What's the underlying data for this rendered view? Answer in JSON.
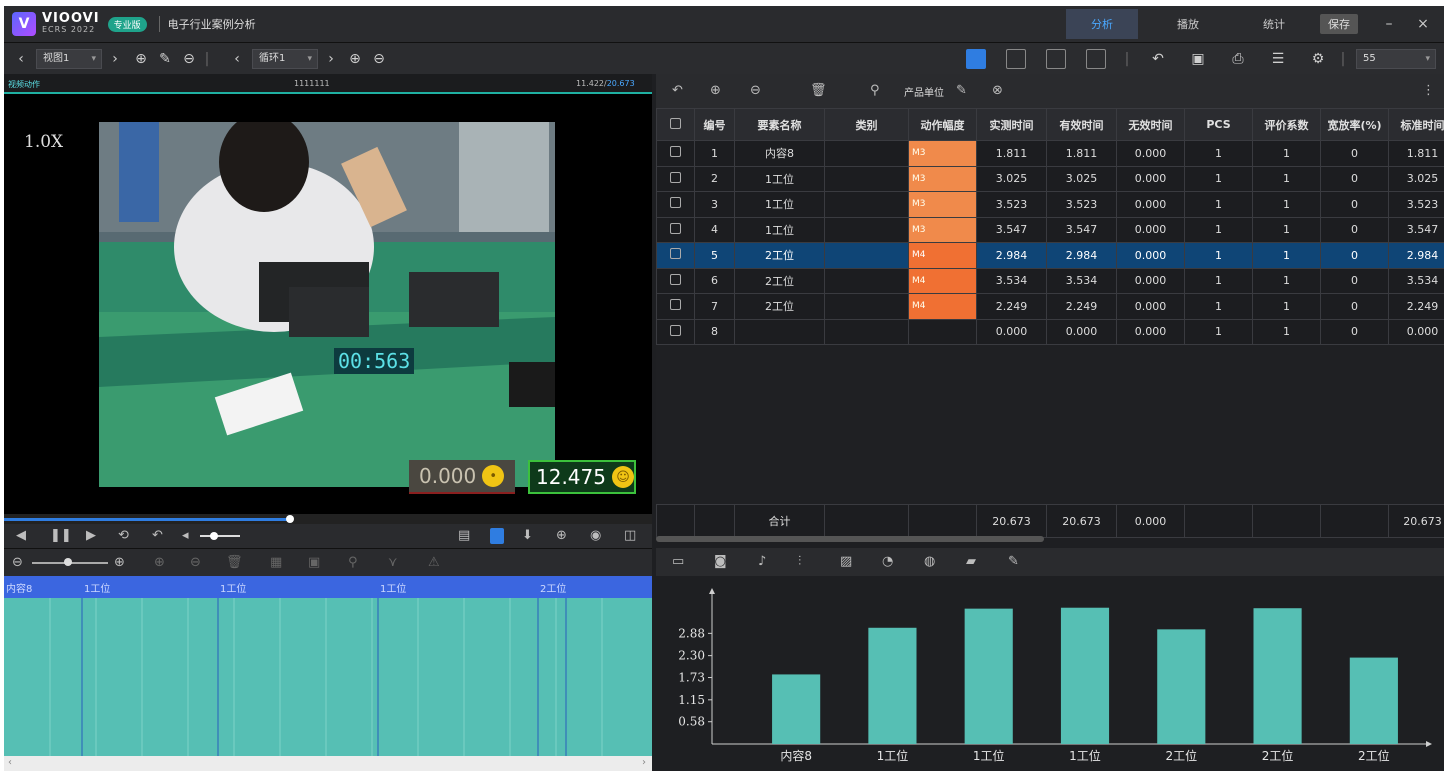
{
  "app": {
    "brand": "VIOOVI",
    "brand_sub": "ECRS 2022",
    "edition_badge": "专业版",
    "document_title": "电子行业案例分析",
    "tabs": [
      {
        "label": "分析",
        "active": true
      },
      {
        "label": "播放",
        "active": false
      },
      {
        "label": "统计",
        "active": false
      }
    ],
    "save_label": "保存",
    "minimize_glyph": "–",
    "close_glyph": "×"
  },
  "toolbar": {
    "view_select": "视图1",
    "series_select": "循环1",
    "right_field": "55"
  },
  "video": {
    "header_left": "视频动作",
    "header_center": "1111111",
    "time_current": "11.422",
    "time_separator": "/",
    "time_total": "20.673",
    "speed": "1.0X",
    "overlay_timer": "00:563",
    "counter_left": "0.000",
    "counter_right": "12.475"
  },
  "table_tools": {
    "unit_label": "产品单位"
  },
  "table": {
    "columns": [
      "编号",
      "要素名称",
      "类别",
      "动作幅度",
      "实测时间",
      "有效时间",
      "无效时间",
      "PCS",
      "评价系数",
      "宽放率(%)",
      "标准时间"
    ],
    "rows": [
      {
        "no": "1",
        "name": "内容8",
        "cat": "",
        "mode": "M3",
        "measured": "1.811",
        "valid": "1.811",
        "invalid": "0.000",
        "pcs": "1",
        "coef": "1",
        "rate": "0",
        "std": "1.811"
      },
      {
        "no": "2",
        "name": "1工位",
        "cat": "",
        "mode": "M3",
        "measured": "3.025",
        "valid": "3.025",
        "invalid": "0.000",
        "pcs": "1",
        "coef": "1",
        "rate": "0",
        "std": "3.025"
      },
      {
        "no": "3",
        "name": "1工位",
        "cat": "",
        "mode": "M3",
        "measured": "3.523",
        "valid": "3.523",
        "invalid": "0.000",
        "pcs": "1",
        "coef": "1",
        "rate": "0",
        "std": "3.523"
      },
      {
        "no": "4",
        "name": "1工位",
        "cat": "",
        "mode": "M3",
        "measured": "3.547",
        "valid": "3.547",
        "invalid": "0.000",
        "pcs": "1",
        "coef": "1",
        "rate": "0",
        "std": "3.547"
      },
      {
        "no": "5",
        "name": "2工位",
        "cat": "",
        "mode": "M4",
        "measured": "2.984",
        "valid": "2.984",
        "invalid": "0.000",
        "pcs": "1",
        "coef": "1",
        "rate": "0",
        "std": "2.984"
      },
      {
        "no": "6",
        "name": "2工位",
        "cat": "",
        "mode": "M4",
        "measured": "3.534",
        "valid": "3.534",
        "invalid": "0.000",
        "pcs": "1",
        "coef": "1",
        "rate": "0",
        "std": "3.534"
      },
      {
        "no": "7",
        "name": "2工位",
        "cat": "",
        "mode": "M4",
        "measured": "2.249",
        "valid": "2.249",
        "invalid": "0.000",
        "pcs": "1",
        "coef": "1",
        "rate": "0",
        "std": "2.249"
      },
      {
        "no": "8",
        "name": "",
        "cat": "",
        "mode": "",
        "measured": "0.000",
        "valid": "0.000",
        "invalid": "0.000",
        "pcs": "1",
        "coef": "1",
        "rate": "0",
        "std": "0.000"
      }
    ],
    "selected_row": 4,
    "total": {
      "label": "合计",
      "measured": "20.673",
      "valid": "20.673",
      "invalid": "0.000",
      "std": "20.673"
    }
  },
  "timeline": {
    "segments": [
      "内容8",
      "1工位",
      "1工位",
      "1工位",
      "2工位"
    ]
  },
  "colors": {
    "accent": "#2f7de1",
    "teal": "#56bfb4",
    "mode_m3": "#f08a4b",
    "mode_m4": "#f07033",
    "selected_row": "#0f4576"
  },
  "chart_data": {
    "type": "bar",
    "categories": [
      "内容8",
      "1工位",
      "1工位",
      "1工位",
      "2工位",
      "2工位",
      "2工位"
    ],
    "values": [
      1.811,
      3.025,
      3.523,
      3.547,
      2.984,
      3.534,
      2.249
    ],
    "yticks": [
      "0.58",
      "1.15",
      "1.73",
      "2.30",
      "2.88"
    ],
    "ytick_values": [
      0.58,
      1.15,
      1.73,
      2.3,
      2.88
    ],
    "ylim": [
      0,
      3.8
    ],
    "bar_color": "#56bfb4",
    "grid": false,
    "title": "",
    "xlabel": "",
    "ylabel": ""
  }
}
